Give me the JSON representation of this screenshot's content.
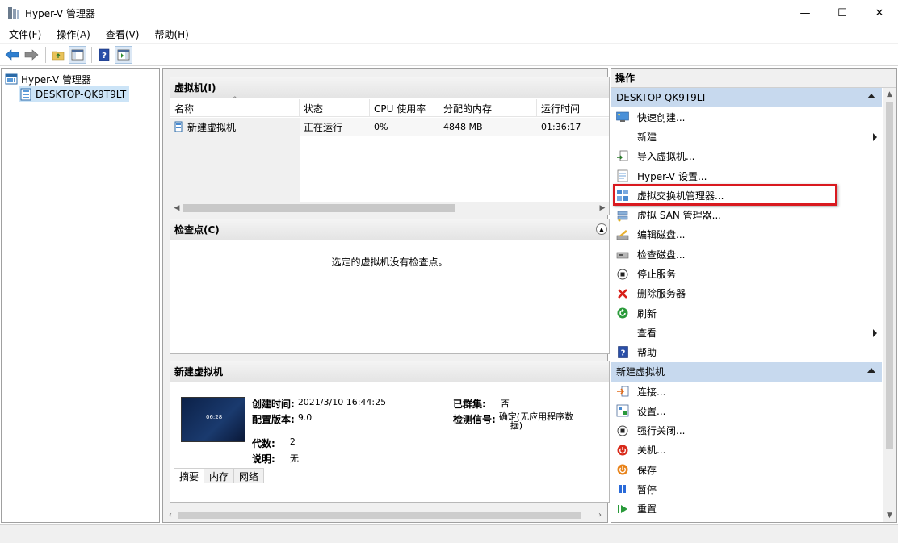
{
  "window": {
    "title": "Hyper-V 管理器",
    "minimize": "—",
    "maximize": "☐",
    "close": "✕"
  },
  "menu": [
    "文件(F)",
    "操作(A)",
    "查看(V)",
    "帮助(H)"
  ],
  "tree": {
    "root": "Hyper-V 管理器",
    "server": "DESKTOP-QK9T9LT"
  },
  "vm_panel": {
    "title": "虚拟机(I)",
    "columns": [
      "名称",
      "状态",
      "CPU 使用率",
      "分配的内存",
      "运行时间"
    ],
    "rows": [
      {
        "name": "新建虚拟机",
        "state": "正在运行",
        "cpu": "0%",
        "memory": "4848 MB",
        "uptime": "01:36:17"
      }
    ]
  },
  "checkpoint_panel": {
    "title": "检查点(C)",
    "message": "选定的虚拟机没有检查点。"
  },
  "detail_panel": {
    "title": "新建虚拟机",
    "thumb_clock": "06:28",
    "created_label": "创建时间:",
    "created_value": "2021/3/10 16:44:25",
    "config_label": "配置版本:",
    "config_value": "9.0",
    "gen_label": "代数:",
    "gen_value": "2",
    "notes_label": "说明:",
    "notes_value": "无",
    "clustered_label": "已群集:",
    "clustered_value": "否",
    "heartbeat_label": "检测信号:",
    "heartbeat_value_1": "确定(无应用程序数",
    "heartbeat_value_2": "据)",
    "tabs": [
      "摘要",
      "内存",
      "网络"
    ]
  },
  "actions": {
    "title": "操作",
    "server_section": "DESKTOP-QK9T9LT",
    "server_items": [
      {
        "label": "快速创建...",
        "icon": "quick-create-icon"
      },
      {
        "label": "新建",
        "icon": "none",
        "submenu": true
      },
      {
        "label": "导入虚拟机...",
        "icon": "import-icon"
      },
      {
        "label": "Hyper-V 设置...",
        "icon": "settings-page-icon"
      },
      {
        "label": "虚拟交换机管理器...",
        "icon": "switch-manager-icon"
      },
      {
        "label": "虚拟 SAN 管理器...",
        "icon": "san-manager-icon"
      },
      {
        "label": "编辑磁盘...",
        "icon": "edit-disk-icon"
      },
      {
        "label": "检查磁盘...",
        "icon": "inspect-disk-icon"
      },
      {
        "label": "停止服务",
        "icon": "stop-service-icon"
      },
      {
        "label": "删除服务器",
        "icon": "delete-icon"
      },
      {
        "label": "刷新",
        "icon": "refresh-icon"
      },
      {
        "label": "查看",
        "icon": "none",
        "submenu": true
      },
      {
        "label": "帮助",
        "icon": "help-icon"
      }
    ],
    "vm_section": "新建虚拟机",
    "vm_items": [
      {
        "label": "连接...",
        "icon": "connect-icon"
      },
      {
        "label": "设置...",
        "icon": "vm-settings-icon"
      },
      {
        "label": "强行关闭...",
        "icon": "turn-off-icon"
      },
      {
        "label": "关机...",
        "icon": "shutdown-icon"
      },
      {
        "label": "保存",
        "icon": "save-icon"
      },
      {
        "label": "暂停",
        "icon": "pause-icon"
      },
      {
        "label": "重置",
        "icon": "reset-icon"
      }
    ]
  },
  "colors": {
    "accent": "#c7d9ee",
    "selected": "#cce4f7",
    "highlight_box": "#d9191f"
  }
}
